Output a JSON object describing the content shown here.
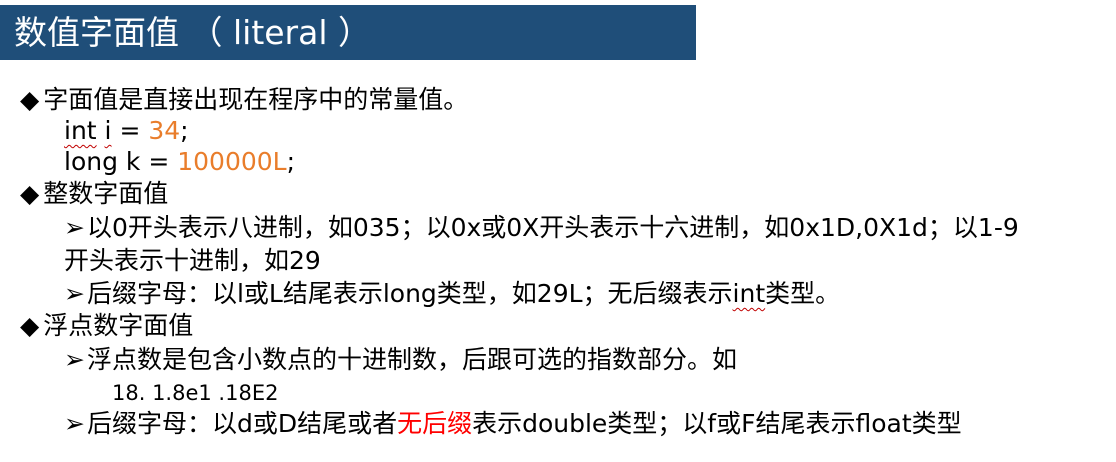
{
  "title": "数值字面值 （ literal ）",
  "colors": {
    "title_bg": "#1f4e79",
    "number": "#e97d2b",
    "highlight": "#ff0000"
  },
  "icons": {
    "diamond_bullet": "◆",
    "arrow_bullet": "➢"
  },
  "intro": {
    "heading": "字面值是直接出现在程序中的常量值。",
    "code1": {
      "kw": "int",
      "sp1": " ",
      "var": "i",
      "rest": " = ",
      "val": "34",
      "end": ";"
    },
    "code2": {
      "pre": "long k = ",
      "val": "100000L",
      "end": ";"
    }
  },
  "integer": {
    "heading": "整数字面值",
    "item1_a": "以0开头表示八进制，如035；以0x或0X开头表示十六进制，如0x1D,0X1d；以1-9",
    "item1_b": "开头表示十进制，如29",
    "item2_a": "后缀字母：以l或L结尾表示long类型，如29L；无后缀表示",
    "item2_b": "int",
    "item2_c": "类型。"
  },
  "float": {
    "heading": "浮点数字面值",
    "item1": "浮点数是包含小数点的十进制数，后跟可选的指数部分。如",
    "example": "18.  1.8e1 .18E2",
    "item2_a": "后缀字母：以d或D结尾或者",
    "item2_b": "无后缀",
    "item2_c": "表示double类型；以f或F结尾表示float类型"
  }
}
